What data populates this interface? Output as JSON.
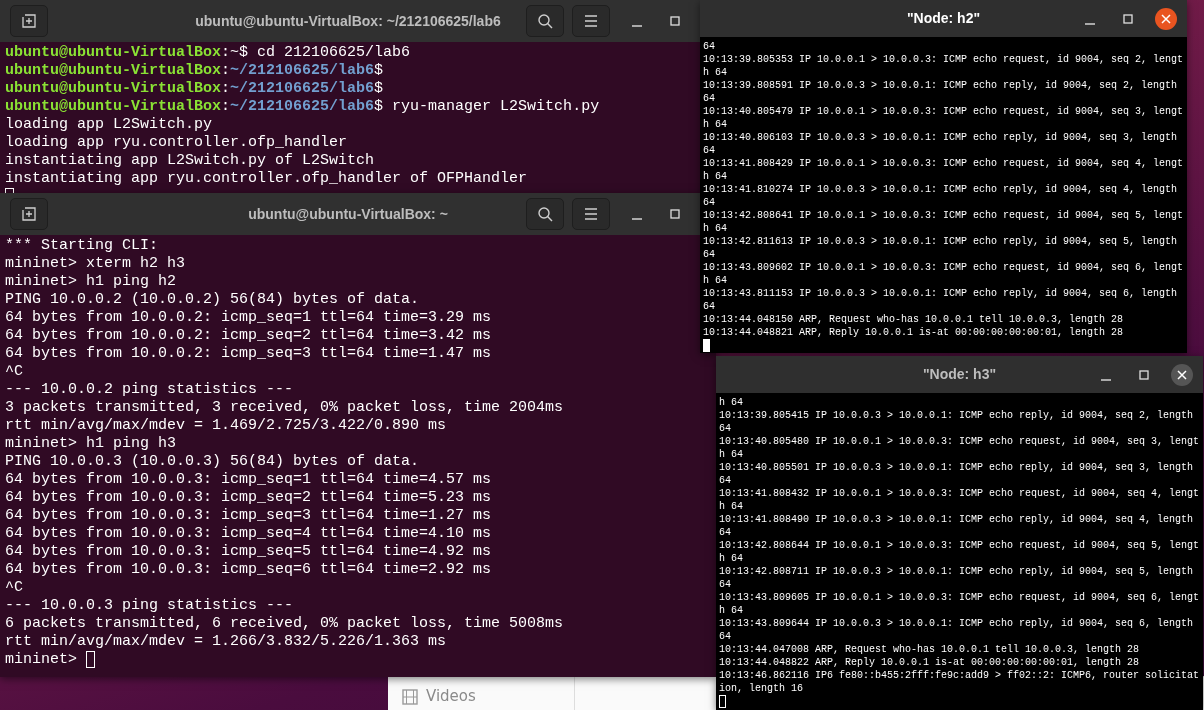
{
  "background_window": {
    "sidebar_item": "Videos"
  },
  "windows": [
    {
      "kind": "gnome-terminal",
      "title": "ubuntu@ubuntu-VirtualBox: ~/212106625/lab6",
      "focused": false,
      "lines": [
        {
          "segments": [
            {
              "kind": "user",
              "text": "ubuntu@ubuntu-VirtualBox"
            },
            {
              "kind": "plain",
              "text": ":~$ cd 212106625/lab6"
            }
          ]
        },
        {
          "segments": [
            {
              "kind": "user",
              "text": "ubuntu@ubuntu-VirtualBox"
            },
            {
              "kind": "plain",
              "text": ":"
            },
            {
              "kind": "path",
              "text": "~/212106625/lab6"
            },
            {
              "kind": "plain",
              "text": "$"
            }
          ]
        },
        {
          "segments": [
            {
              "kind": "user",
              "text": "ubuntu@ubuntu-VirtualBox"
            },
            {
              "kind": "plain",
              "text": ":"
            },
            {
              "kind": "path",
              "text": "~/212106625/lab6"
            },
            {
              "kind": "plain",
              "text": "$"
            }
          ]
        },
        {
          "segments": [
            {
              "kind": "user",
              "text": "ubuntu@ubuntu-VirtualBox"
            },
            {
              "kind": "plain",
              "text": ":"
            },
            {
              "kind": "path",
              "text": "~/212106625/lab6"
            },
            {
              "kind": "plain",
              "text": "$ ryu-manager L2Switch.py"
            }
          ]
        },
        {
          "segments": [
            {
              "kind": "plain",
              "text": "loading app L2Switch.py"
            }
          ]
        },
        {
          "segments": [
            {
              "kind": "plain",
              "text": "loading app ryu.controller.ofp_handler"
            }
          ]
        },
        {
          "segments": [
            {
              "kind": "plain",
              "text": "instantiating app L2Switch.py of L2Switch"
            }
          ]
        },
        {
          "segments": [
            {
              "kind": "plain",
              "text": "instantiating app ryu.controller.ofp_handler of OFPHandler"
            }
          ]
        }
      ]
    },
    {
      "kind": "gnome-terminal",
      "title": "ubuntu@ubuntu-VirtualBox: ~",
      "focused": false,
      "input_line": "mininet> ",
      "lines": [
        {
          "segments": [
            {
              "kind": "plain",
              "text": "*** Starting CLI:"
            }
          ]
        },
        {
          "segments": [
            {
              "kind": "plain",
              "text": "mininet> xterm h2 h3"
            }
          ]
        },
        {
          "segments": [
            {
              "kind": "plain",
              "text": "mininet> h1 ping h2"
            }
          ]
        },
        {
          "segments": [
            {
              "kind": "plain",
              "text": "PING 10.0.0.2 (10.0.0.2) 56(84) bytes of data."
            }
          ]
        },
        {
          "segments": [
            {
              "kind": "plain",
              "text": "64 bytes from 10.0.0.2: icmp_seq=1 ttl=64 time=3.29 ms"
            }
          ]
        },
        {
          "segments": [
            {
              "kind": "plain",
              "text": "64 bytes from 10.0.0.2: icmp_seq=2 ttl=64 time=3.42 ms"
            }
          ]
        },
        {
          "segments": [
            {
              "kind": "plain",
              "text": "64 bytes from 10.0.0.2: icmp_seq=3 ttl=64 time=1.47 ms"
            }
          ]
        },
        {
          "segments": [
            {
              "kind": "plain",
              "text": "^C"
            }
          ]
        },
        {
          "segments": [
            {
              "kind": "plain",
              "text": "--- 10.0.0.2 ping statistics ---"
            }
          ]
        },
        {
          "segments": [
            {
              "kind": "plain",
              "text": "3 packets transmitted, 3 received, 0% packet loss, time 2004ms"
            }
          ]
        },
        {
          "segments": [
            {
              "kind": "plain",
              "text": "rtt min/avg/max/mdev = 1.469/2.725/3.422/0.890 ms"
            }
          ]
        },
        {
          "segments": [
            {
              "kind": "plain",
              "text": "mininet> h1 ping h3"
            }
          ]
        },
        {
          "segments": [
            {
              "kind": "plain",
              "text": "PING 10.0.0.3 (10.0.0.3) 56(84) bytes of data."
            }
          ]
        },
        {
          "segments": [
            {
              "kind": "plain",
              "text": "64 bytes from 10.0.0.3: icmp_seq=1 ttl=64 time=4.57 ms"
            }
          ]
        },
        {
          "segments": [
            {
              "kind": "plain",
              "text": "64 bytes from 10.0.0.3: icmp_seq=2 ttl=64 time=5.23 ms"
            }
          ]
        },
        {
          "segments": [
            {
              "kind": "plain",
              "text": "64 bytes from 10.0.0.3: icmp_seq=3 ttl=64 time=1.27 ms"
            }
          ]
        },
        {
          "segments": [
            {
              "kind": "plain",
              "text": "64 bytes from 10.0.0.3: icmp_seq=4 ttl=64 time=4.10 ms"
            }
          ]
        },
        {
          "segments": [
            {
              "kind": "plain",
              "text": "64 bytes from 10.0.0.3: icmp_seq=5 ttl=64 time=4.92 ms"
            }
          ]
        },
        {
          "segments": [
            {
              "kind": "plain",
              "text": "64 bytes from 10.0.0.3: icmp_seq=6 ttl=64 time=2.92 ms"
            }
          ]
        },
        {
          "segments": [
            {
              "kind": "plain",
              "text": "^C"
            }
          ]
        },
        {
          "segments": [
            {
              "kind": "plain",
              "text": "--- 10.0.0.3 ping statistics ---"
            }
          ]
        },
        {
          "segments": [
            {
              "kind": "plain",
              "text": "6 packets transmitted, 6 received, 0% packet loss, time 5008ms"
            }
          ]
        },
        {
          "segments": [
            {
              "kind": "plain",
              "text": "rtt min/avg/max/mdev = 1.266/3.832/5.226/1.363 ms"
            }
          ]
        }
      ]
    },
    {
      "kind": "xterm",
      "title": "\"Node: h2\"",
      "focused": true,
      "lines": [
        {
          "segments": [
            {
              "kind": "plain",
              "text": "64"
            }
          ]
        },
        {
          "segments": [
            {
              "kind": "plain",
              "text": "10:13:39.805353 IP 10.0.0.1 > 10.0.0.3: ICMP echo request, id 9004, seq 2, lengt"
            }
          ]
        },
        {
          "segments": [
            {
              "kind": "plain",
              "text": "h 64"
            }
          ]
        },
        {
          "segments": [
            {
              "kind": "plain",
              "text": "10:13:39.808591 IP 10.0.0.3 > 10.0.0.1: ICMP echo reply, id 9004, seq 2, length"
            }
          ]
        },
        {
          "segments": [
            {
              "kind": "plain",
              "text": "64"
            }
          ]
        },
        {
          "segments": [
            {
              "kind": "plain",
              "text": "10:13:40.805479 IP 10.0.0.1 > 10.0.0.3: ICMP echo request, id 9004, seq 3, lengt"
            }
          ]
        },
        {
          "segments": [
            {
              "kind": "plain",
              "text": "h 64"
            }
          ]
        },
        {
          "segments": [
            {
              "kind": "plain",
              "text": "10:13:40.806103 IP 10.0.0.3 > 10.0.0.1: ICMP echo reply, id 9004, seq 3, length"
            }
          ]
        },
        {
          "segments": [
            {
              "kind": "plain",
              "text": "64"
            }
          ]
        },
        {
          "segments": [
            {
              "kind": "plain",
              "text": "10:13:41.808429 IP 10.0.0.1 > 10.0.0.3: ICMP echo request, id 9004, seq 4, lengt"
            }
          ]
        },
        {
          "segments": [
            {
              "kind": "plain",
              "text": "h 64"
            }
          ]
        },
        {
          "segments": [
            {
              "kind": "plain",
              "text": "10:13:41.810274 IP 10.0.0.3 > 10.0.0.1: ICMP echo reply, id 9004, seq 4, length"
            }
          ]
        },
        {
          "segments": [
            {
              "kind": "plain",
              "text": "64"
            }
          ]
        },
        {
          "segments": [
            {
              "kind": "plain",
              "text": "10:13:42.808641 IP 10.0.0.1 > 10.0.0.3: ICMP echo request, id 9004, seq 5, lengt"
            }
          ]
        },
        {
          "segments": [
            {
              "kind": "plain",
              "text": "h 64"
            }
          ]
        },
        {
          "segments": [
            {
              "kind": "plain",
              "text": "10:13:42.811613 IP 10.0.0.3 > 10.0.0.1: ICMP echo reply, id 9004, seq 5, length"
            }
          ]
        },
        {
          "segments": [
            {
              "kind": "plain",
              "text": "64"
            }
          ]
        },
        {
          "segments": [
            {
              "kind": "plain",
              "text": "10:13:43.809602 IP 10.0.0.1 > 10.0.0.3: ICMP echo request, id 9004, seq 6, lengt"
            }
          ]
        },
        {
          "segments": [
            {
              "kind": "plain",
              "text": "h 64"
            }
          ]
        },
        {
          "segments": [
            {
              "kind": "plain",
              "text": "10:13:43.811153 IP 10.0.0.3 > 10.0.0.1: ICMP echo reply, id 9004, seq 6, length"
            }
          ]
        },
        {
          "segments": [
            {
              "kind": "plain",
              "text": "64"
            }
          ]
        },
        {
          "segments": [
            {
              "kind": "plain",
              "text": "10:13:44.048150 ARP, Request who-has 10.0.0.1 tell 10.0.0.3, length 28"
            }
          ]
        },
        {
          "segments": [
            {
              "kind": "plain",
              "text": "10:13:44.048821 ARP, Reply 10.0.0.1 is-at 00:00:00:00:00:01, length 28"
            }
          ]
        }
      ]
    },
    {
      "kind": "xterm",
      "title": "\"Node: h3\"",
      "focused": false,
      "lines": [
        {
          "segments": [
            {
              "kind": "plain",
              "text": "h 64"
            }
          ]
        },
        {
          "segments": [
            {
              "kind": "plain",
              "text": "10:13:39.805415 IP 10.0.0.3 > 10.0.0.1: ICMP echo reply, id 9004, seq 2, length"
            }
          ]
        },
        {
          "segments": [
            {
              "kind": "plain",
              "text": "64"
            }
          ]
        },
        {
          "segments": [
            {
              "kind": "plain",
              "text": "10:13:40.805480 IP 10.0.0.1 > 10.0.0.3: ICMP echo request, id 9004, seq 3, lengt"
            }
          ]
        },
        {
          "segments": [
            {
              "kind": "plain",
              "text": "h 64"
            }
          ]
        },
        {
          "segments": [
            {
              "kind": "plain",
              "text": "10:13:40.805501 IP 10.0.0.3 > 10.0.0.1: ICMP echo reply, id 9004, seq 3, length"
            }
          ]
        },
        {
          "segments": [
            {
              "kind": "plain",
              "text": "64"
            }
          ]
        },
        {
          "segments": [
            {
              "kind": "plain",
              "text": "10:13:41.808432 IP 10.0.0.1 > 10.0.0.3: ICMP echo request, id 9004, seq 4, lengt"
            }
          ]
        },
        {
          "segments": [
            {
              "kind": "plain",
              "text": "h 64"
            }
          ]
        },
        {
          "segments": [
            {
              "kind": "plain",
              "text": "10:13:41.808490 IP 10.0.0.3 > 10.0.0.1: ICMP echo reply, id 9004, seq 4, length"
            }
          ]
        },
        {
          "segments": [
            {
              "kind": "plain",
              "text": "64"
            }
          ]
        },
        {
          "segments": [
            {
              "kind": "plain",
              "text": "10:13:42.808644 IP 10.0.0.1 > 10.0.0.3: ICMP echo request, id 9004, seq 5, lengt"
            }
          ]
        },
        {
          "segments": [
            {
              "kind": "plain",
              "text": "h 64"
            }
          ]
        },
        {
          "segments": [
            {
              "kind": "plain",
              "text": "10:13:42.808711 IP 10.0.0.3 > 10.0.0.1: ICMP echo reply, id 9004, seq 5, length"
            }
          ]
        },
        {
          "segments": [
            {
              "kind": "plain",
              "text": "64"
            }
          ]
        },
        {
          "segments": [
            {
              "kind": "plain",
              "text": "10:13:43.809605 IP 10.0.0.1 > 10.0.0.3: ICMP echo request, id 9004, seq 6, lengt"
            }
          ]
        },
        {
          "segments": [
            {
              "kind": "plain",
              "text": "h 64"
            }
          ]
        },
        {
          "segments": [
            {
              "kind": "plain",
              "text": "10:13:43.809644 IP 10.0.0.3 > 10.0.0.1: ICMP echo reply, id 9004, seq 6, length"
            }
          ]
        },
        {
          "segments": [
            {
              "kind": "plain",
              "text": "64"
            }
          ]
        },
        {
          "segments": [
            {
              "kind": "plain",
              "text": "10:13:44.047008 ARP, Request who-has 10.0.0.1 tell 10.0.0.3, length 28"
            }
          ]
        },
        {
          "segments": [
            {
              "kind": "plain",
              "text": "10:13:44.048822 ARP, Reply 10.0.0.1 is-at 00:00:00:00:00:01, length 28"
            }
          ]
        },
        {
          "segments": [
            {
              "kind": "plain",
              "text": "10:13:46.862116 IP6 fe80::b455:2fff:fe9c:add9 > ff02::2: ICMP6, router solicitat"
            }
          ]
        },
        {
          "segments": [
            {
              "kind": "plain",
              "text": "ion, length 16"
            }
          ]
        }
      ]
    }
  ]
}
